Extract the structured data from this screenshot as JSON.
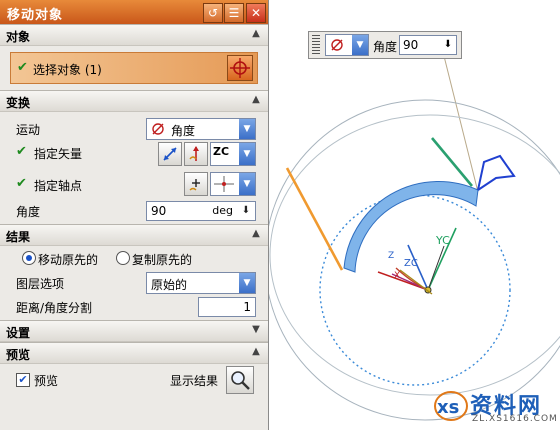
{
  "dialog": {
    "title": "移动对象",
    "buttons": {
      "reset": "↺",
      "menu": "☰",
      "close": "✕"
    }
  },
  "objects": {
    "header": "对象",
    "select_label": "选择对象 (1)"
  },
  "transform": {
    "header": "变换",
    "motion_label": "运动",
    "motion_value": "角度",
    "vector_label": "指定矢量",
    "vector_axis": "ZC",
    "pivot_label": "指定轴点",
    "angle_label": "角度",
    "angle_value": "90",
    "angle_unit": "deg"
  },
  "result": {
    "header": "结果",
    "move_original": "移动原先的",
    "copy_original": "复制原先的",
    "layer_label": "图层选项",
    "layer_value": "原始的",
    "split_label": "距离/角度分割",
    "split_value": "1"
  },
  "settings": {
    "header": "设置"
  },
  "preview": {
    "header": "预览",
    "preview_label": "预览",
    "show_result": "显示结果"
  },
  "float_widget": {
    "label": "角度",
    "value": "90"
  },
  "viewport": {
    "yc": "YC",
    "zc": "ZC",
    "z": "Z",
    "x": "X"
  },
  "watermark": {
    "brand": "资料网",
    "url": "ZL.XS1616.COM"
  },
  "colors": {
    "titlebar": "#d8661e",
    "accent_blue": "#3b6fc8",
    "check_green": "#1e8a1e"
  }
}
